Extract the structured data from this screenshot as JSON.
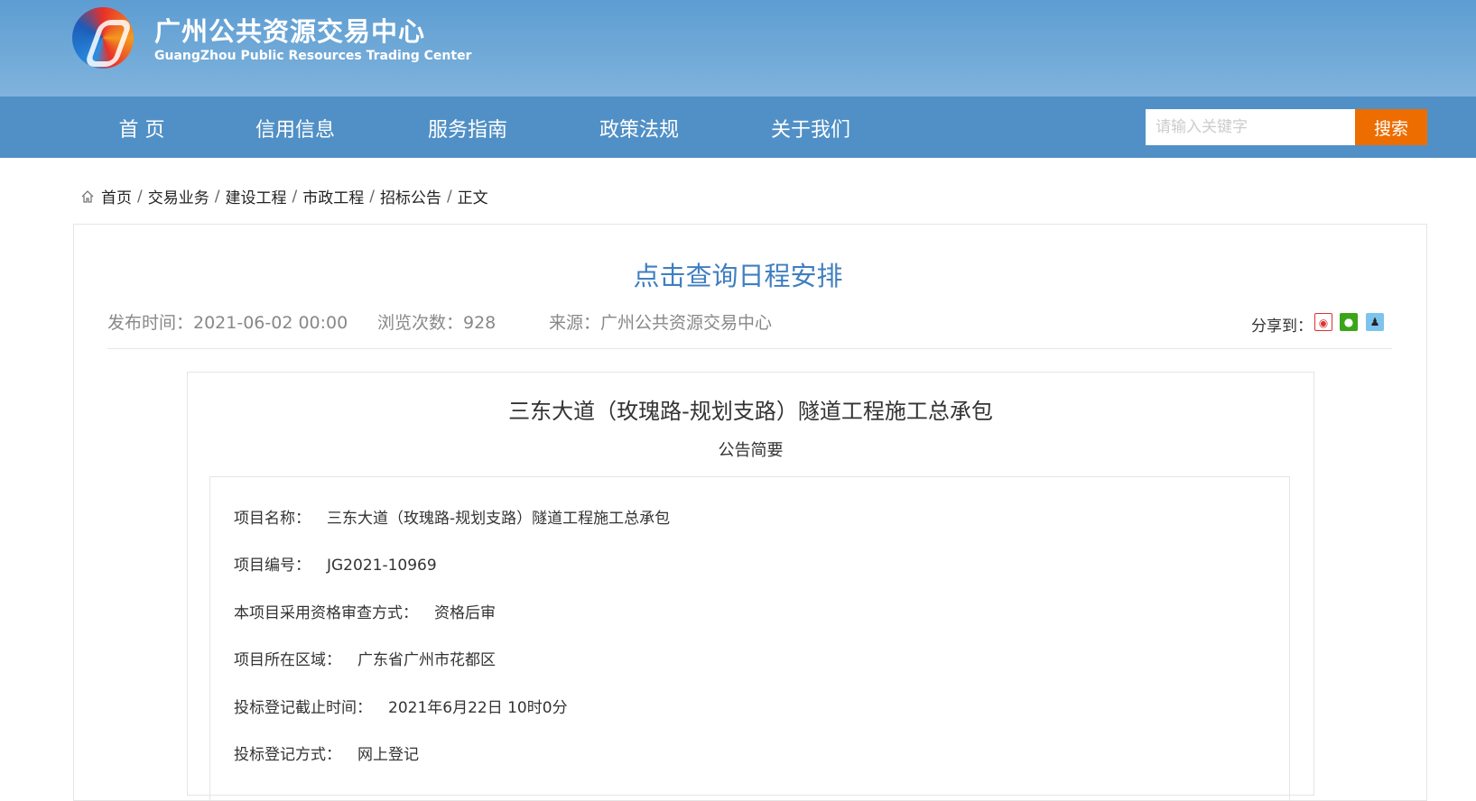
{
  "header": {
    "title": "广州公共资源交易中心",
    "subtitle": "GuangZhou Public Resources Trading Center"
  },
  "nav": {
    "items": [
      "首 页",
      "信用信息",
      "服务指南",
      "政策法规",
      "关于我们"
    ],
    "search_placeholder": "请输入关键字",
    "search_label": "搜索"
  },
  "breadcrumb": [
    "首页",
    "交易业务",
    "建设工程",
    "市政工程",
    "招标公告",
    "正文"
  ],
  "article": {
    "schedule_link": "点击查询日程安排",
    "publish_time": "发布时间：2021-06-02 00:00",
    "views": "浏览次数：928",
    "source": "来源：广州公共资源交易中心",
    "share_label": "分享到：",
    "title": "三东大道（玫瑰路-规划支路）隧道工程施工总承包",
    "subtitle": "公告简要",
    "fields": [
      {
        "label": "项目名称：",
        "value": "三东大道（玫瑰路-规划支路）隧道工程施工总承包"
      },
      {
        "label": "项目编号：",
        "value": "JG2021-10969"
      },
      {
        "label": "本项目采用资格审查方式：",
        "value": "资格后审"
      },
      {
        "label": "项目所在区域：",
        "value": "广东省广州市花都区"
      },
      {
        "label": "投标登记截止时间：",
        "value": "2021年6月22日 10时0分"
      },
      {
        "label": "投标登记方式：",
        "value": "网上登记"
      }
    ]
  },
  "colors": {
    "accent": "#ed6d00",
    "nav": "#5190c6",
    "link": "#3f7fc0"
  }
}
